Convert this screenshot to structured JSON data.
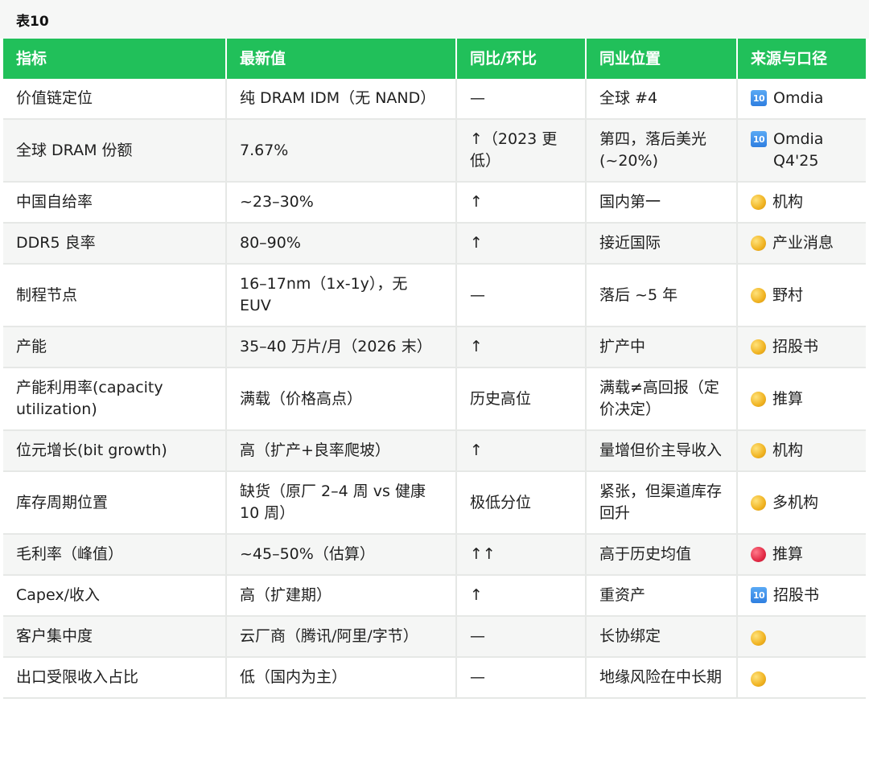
{
  "title": "表10",
  "headers": [
    "指标",
    "最新值",
    "同比/环比",
    "同业位置",
    "来源与口径"
  ],
  "rows": [
    {
      "metric": "价值链定位",
      "value": "纯 DRAM IDM（无 NAND）",
      "change": "—",
      "peer": "全球 #4",
      "source_icon": "keycap-10-icon",
      "source": "Omdia"
    },
    {
      "metric": "全球 DRAM 份额",
      "value": "7.67%",
      "change": "↑（2023 更低）",
      "peer": "第四，落后美光 (~20%)",
      "source_icon": "keycap-10-icon",
      "source": "Omdia Q4'25"
    },
    {
      "metric": "中国自给率",
      "value": "~23–30%",
      "change": "↑",
      "peer": "国内第一",
      "source_icon": "yellow-circle-icon",
      "source": "机构"
    },
    {
      "metric": "DDR5 良率",
      "value": "80–90%",
      "change": "↑",
      "peer": "接近国际",
      "source_icon": "yellow-circle-icon",
      "source": "产业消息"
    },
    {
      "metric": "制程节点",
      "value": "16–17nm（1x-1y），无 EUV",
      "change": "—",
      "peer": "落后 ~5 年",
      "source_icon": "yellow-circle-icon",
      "source": "野村"
    },
    {
      "metric": "产能",
      "value": "35–40 万片/月（2026 末）",
      "change": "↑",
      "peer": "扩产中",
      "source_icon": "yellow-circle-icon",
      "source": "招股书"
    },
    {
      "metric": "产能利用率(capacity utilization)",
      "value": "满载（价格高点）",
      "change": "历史高位",
      "peer": "满载≠高回报（定价决定）",
      "source_icon": "yellow-circle-icon",
      "source": "推算"
    },
    {
      "metric": "位元增长(bit growth)",
      "value": "高（扩产+良率爬坡）",
      "change": "↑",
      "peer": "量增但价主导收入",
      "source_icon": "yellow-circle-icon",
      "source": "机构"
    },
    {
      "metric": "库存周期位置",
      "value": "缺货（原厂 2–4 周 vs 健康 10 周）",
      "change": "极低分位",
      "peer": "紧张，但渠道库存回升",
      "source_icon": "yellow-circle-icon",
      "source": "多机构"
    },
    {
      "metric": "毛利率（峰值）",
      "value": "~45–50%（估算）",
      "change": "↑↑",
      "peer": "高于历史均值",
      "source_icon": "red-circle-icon",
      "source": "推算"
    },
    {
      "metric": "Capex/收入",
      "value": "高（扩建期）",
      "change": "↑",
      "peer": "重资产",
      "source_icon": "keycap-10-icon",
      "source": "招股书"
    },
    {
      "metric": "客户集中度",
      "value": "云厂商（腾讯/阿里/字节）",
      "change": "—",
      "peer": "长协绑定",
      "source_icon": "yellow-circle-icon",
      "source": ""
    },
    {
      "metric": "出口受限收入占比",
      "value": "低（国内为主）",
      "change": "—",
      "peer": "地缘风险在中长期",
      "source_icon": "yellow-circle-icon",
      "source": ""
    }
  ],
  "colors": {
    "header_bg": "#21c05a",
    "header_text": "#ffffff",
    "stripe": "#f5f6f5",
    "border": "#e6e8e6"
  }
}
